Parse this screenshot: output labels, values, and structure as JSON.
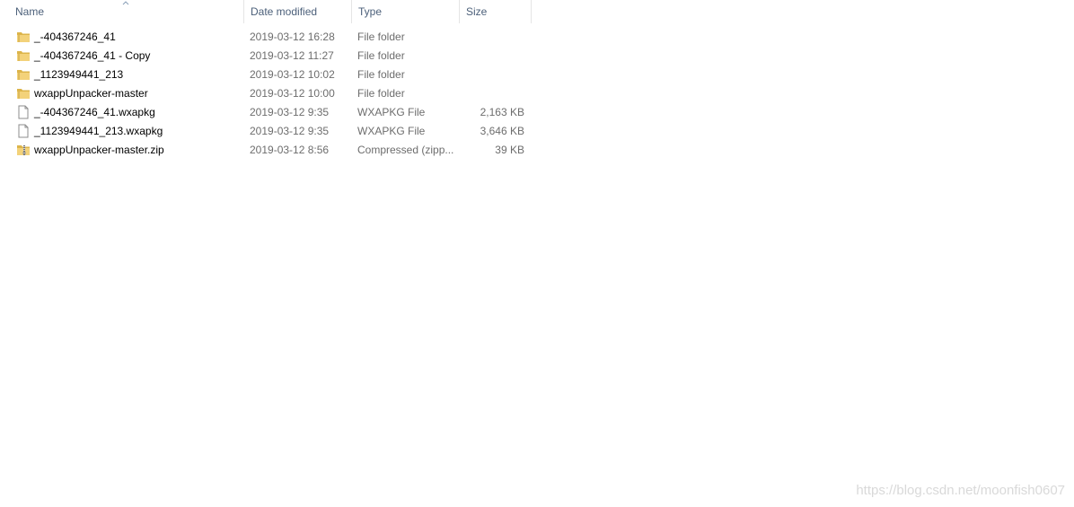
{
  "columns": {
    "name": "Name",
    "date": "Date modified",
    "type": "Type",
    "size": "Size"
  },
  "sort": {
    "column": "name",
    "icon": "sort-ascending-icon"
  },
  "files": [
    {
      "name": "_-404367246_41",
      "date": "2019-03-12 16:28",
      "type": "File folder",
      "size": "",
      "icon": "folder-icon"
    },
    {
      "name": "_-404367246_41 - Copy",
      "date": "2019-03-12 11:27",
      "type": "File folder",
      "size": "",
      "icon": "folder-icon"
    },
    {
      "name": "_1123949441_213",
      "date": "2019-03-12 10:02",
      "type": "File folder",
      "size": "",
      "icon": "folder-icon"
    },
    {
      "name": "wxappUnpacker-master",
      "date": "2019-03-12 10:00",
      "type": "File folder",
      "size": "",
      "icon": "folder-icon"
    },
    {
      "name": "_-404367246_41.wxapkg",
      "date": "2019-03-12 9:35",
      "type": "WXAPKG File",
      "size": "2,163 KB",
      "icon": "file-icon"
    },
    {
      "name": "_1123949441_213.wxapkg",
      "date": "2019-03-12 9:35",
      "type": "WXAPKG File",
      "size": "3,646 KB",
      "icon": "file-icon"
    },
    {
      "name": "wxappUnpacker-master.zip",
      "date": "2019-03-12 8:56",
      "type": "Compressed (zipp...",
      "size": "39 KB",
      "icon": "zip-folder-icon"
    }
  ],
  "watermark": "https://blog.csdn.net/moonfish0607",
  "colors": {
    "header_text": "#4c607a",
    "detail_text": "#6d6d6d",
    "folder_yellow": "#e8c45a"
  }
}
